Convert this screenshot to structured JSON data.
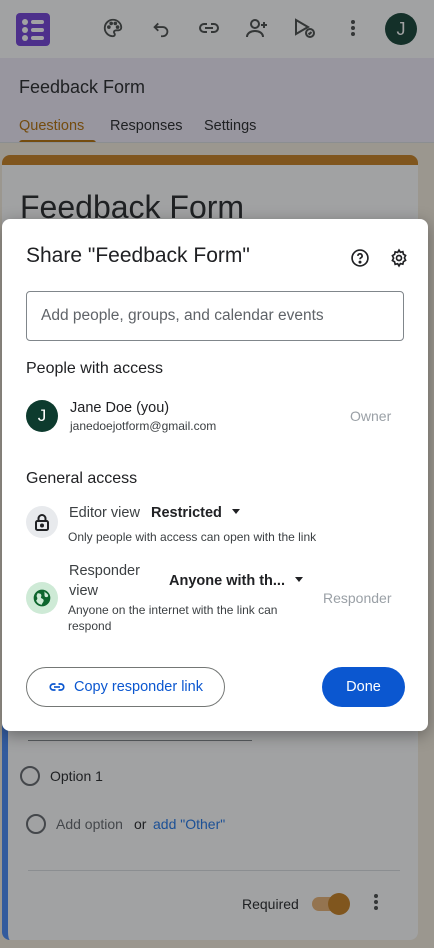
{
  "app": {
    "form_name": "Feedback Form",
    "avatar_initial": "J",
    "tabs": [
      {
        "label": "Questions",
        "active": true
      },
      {
        "label": "Responses",
        "active": false
      },
      {
        "label": "Settings",
        "active": false
      }
    ],
    "toolbar_icons": [
      "palette-icon",
      "undo-icon",
      "link-icon",
      "add-collaborator-icon",
      "preview-icon",
      "more-vert-icon"
    ]
  },
  "form": {
    "title": "Feedback Form",
    "question": {
      "option_1": "Option 1",
      "add_option": "Add option",
      "or_text": "or",
      "add_other": "add \"Other\"",
      "required_label": "Required",
      "required_on": true
    }
  },
  "share_dialog": {
    "title": "Share \"Feedback Form\"",
    "add_placeholder": "Add people, groups, and calendar events",
    "people_heading": "People with access",
    "person": {
      "initial": "J",
      "name": "Jane Doe (you)",
      "email": "janedoejotform@gmail.com",
      "role": "Owner"
    },
    "general_heading": "General access",
    "editor_view": {
      "label": "Editor view",
      "value": "Restricted",
      "description": "Only people with access can open with the link"
    },
    "responder_view": {
      "label": "Responder view",
      "value": "Anyone with th...",
      "description": "Anyone on the internet with the link can respond",
      "role": "Responder"
    },
    "copy_link_label": "Copy responder link",
    "done_label": "Done"
  },
  "colors": {
    "accent": "#b26b00",
    "theme_band": "#c77d1a",
    "primary_button": "#0b57d0",
    "avatar": "#0d3b2e"
  }
}
